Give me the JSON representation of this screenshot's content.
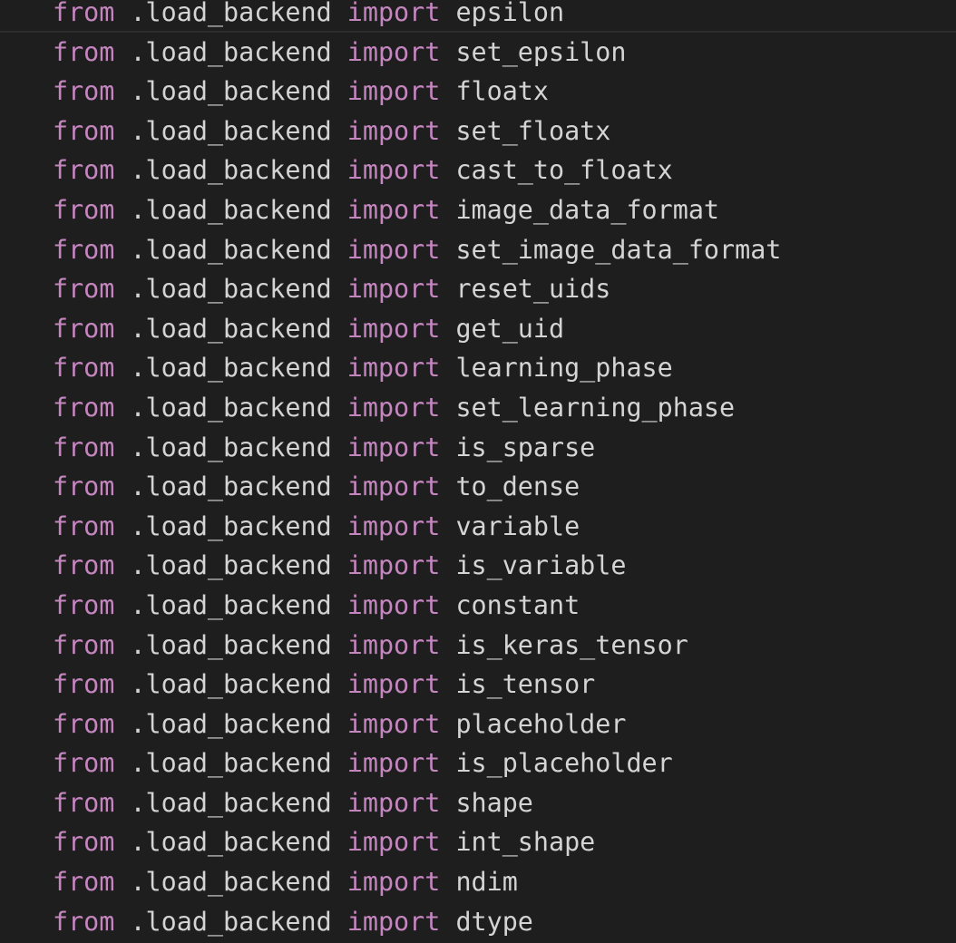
{
  "editor": {
    "keyword_color": "#c586c0",
    "text_color": "#d4d4d4",
    "background_color": "#1e1e1e",
    "lines": [
      {
        "from": "from",
        "module": ".load_backend",
        "import": "import",
        "name": "epsilon"
      },
      {
        "from": "from",
        "module": ".load_backend",
        "import": "import",
        "name": "set_epsilon"
      },
      {
        "from": "from",
        "module": ".load_backend",
        "import": "import",
        "name": "floatx"
      },
      {
        "from": "from",
        "module": ".load_backend",
        "import": "import",
        "name": "set_floatx"
      },
      {
        "from": "from",
        "module": ".load_backend",
        "import": "import",
        "name": "cast_to_floatx"
      },
      {
        "from": "from",
        "module": ".load_backend",
        "import": "import",
        "name": "image_data_format"
      },
      {
        "from": "from",
        "module": ".load_backend",
        "import": "import",
        "name": "set_image_data_format"
      },
      {
        "from": "from",
        "module": ".load_backend",
        "import": "import",
        "name": "reset_uids"
      },
      {
        "from": "from",
        "module": ".load_backend",
        "import": "import",
        "name": "get_uid"
      },
      {
        "from": "from",
        "module": ".load_backend",
        "import": "import",
        "name": "learning_phase"
      },
      {
        "from": "from",
        "module": ".load_backend",
        "import": "import",
        "name": "set_learning_phase"
      },
      {
        "from": "from",
        "module": ".load_backend",
        "import": "import",
        "name": "is_sparse"
      },
      {
        "from": "from",
        "module": ".load_backend",
        "import": "import",
        "name": "to_dense"
      },
      {
        "from": "from",
        "module": ".load_backend",
        "import": "import",
        "name": "variable"
      },
      {
        "from": "from",
        "module": ".load_backend",
        "import": "import",
        "name": "is_variable"
      },
      {
        "from": "from",
        "module": ".load_backend",
        "import": "import",
        "name": "constant"
      },
      {
        "from": "from",
        "module": ".load_backend",
        "import": "import",
        "name": "is_keras_tensor"
      },
      {
        "from": "from",
        "module": ".load_backend",
        "import": "import",
        "name": "is_tensor"
      },
      {
        "from": "from",
        "module": ".load_backend",
        "import": "import",
        "name": "placeholder"
      },
      {
        "from": "from",
        "module": ".load_backend",
        "import": "import",
        "name": "is_placeholder"
      },
      {
        "from": "from",
        "module": ".load_backend",
        "import": "import",
        "name": "shape"
      },
      {
        "from": "from",
        "module": ".load_backend",
        "import": "import",
        "name": "int_shape"
      },
      {
        "from": "from",
        "module": ".load_backend",
        "import": "import",
        "name": "ndim"
      },
      {
        "from": "from",
        "module": ".load_backend",
        "import": "import",
        "name": "dtype"
      }
    ]
  }
}
